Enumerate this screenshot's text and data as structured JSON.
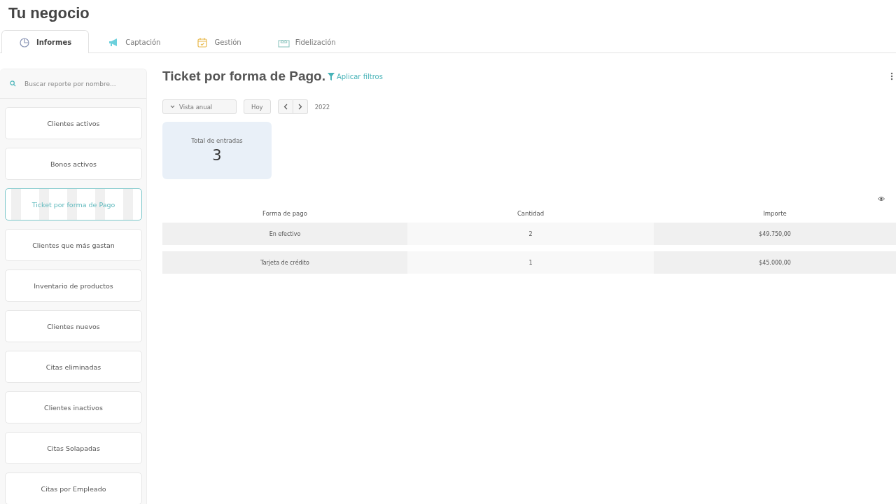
{
  "page_title": "Tu negocio",
  "tabs": [
    {
      "label": "Informes",
      "selected": true
    },
    {
      "label": "Captación",
      "selected": false
    },
    {
      "label": "Gestión",
      "selected": false
    },
    {
      "label": "Fidelización",
      "selected": false
    }
  ],
  "sidebar": {
    "search": {
      "placeholder": "Buscar reporte por nombre..."
    },
    "items": [
      {
        "label": "Clientes activos",
        "selected": false
      },
      {
        "label": "Bonos activos",
        "selected": false
      },
      {
        "label": "Ticket por forma de Pago",
        "selected": true
      },
      {
        "label": "Clientes que más gastan",
        "selected": false
      },
      {
        "label": "Inventario de productos",
        "selected": false
      },
      {
        "label": "Clientes nuevos",
        "selected": false
      },
      {
        "label": "Citas eliminadas",
        "selected": false
      },
      {
        "label": "Clientes inactivos",
        "selected": false
      },
      {
        "label": "Citas Solapadas",
        "selected": false
      },
      {
        "label": "Citas por Empleado",
        "selected": false
      }
    ]
  },
  "report": {
    "title": "Ticket por forma de Pago.",
    "filter_link": "Aplicar filtros",
    "view_select": "Vista anual",
    "today_button": "Hoy",
    "period": "2022",
    "stat": {
      "label": "Total de entradas",
      "value": "3"
    },
    "table": {
      "columns": [
        "Forma de pago",
        "Cantidad",
        "Importe"
      ],
      "rows": [
        [
          "En efectivo",
          "2",
          "$49.750,00"
        ],
        [
          "Tarjeta de crédito",
          "1",
          "$45.000,00"
        ]
      ]
    }
  }
}
